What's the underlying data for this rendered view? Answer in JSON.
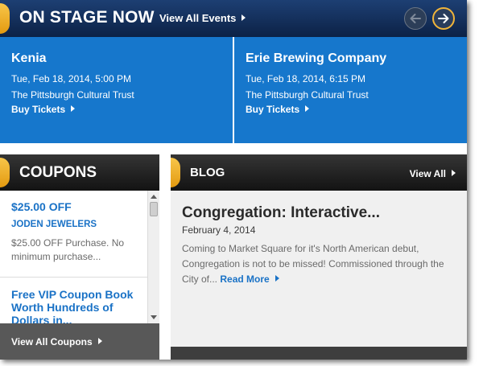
{
  "stage": {
    "title": "ON STAGE NOW",
    "view_all": "View All Events",
    "prev_icon": "arrow-left-icon",
    "next_icon": "arrow-right-icon"
  },
  "events": [
    {
      "name": "Kenia",
      "date": "Tue, Feb 18, 2014, 5:00 PM",
      "venue": "The Pittsburgh Cultural Trust",
      "buy": "Buy Tickets"
    },
    {
      "name": "Erie Brewing Company",
      "date": "Tue, Feb 18, 2014, 6:15 PM",
      "venue": "The Pittsburgh Cultural Trust",
      "buy": "Buy Tickets"
    }
  ],
  "coupons": {
    "title": "COUPONS",
    "items": [
      {
        "title": "$25.00 OFF",
        "merchant": "JODEN JEWELERS",
        "description": "$25.00 OFF Purchase. No minimum purchase..."
      },
      {
        "title": "Free VIP Coupon Book Worth Hundreds of Dollars in..."
      }
    ],
    "view_all": "View All Coupons"
  },
  "blog": {
    "title": "BLOG",
    "view_all": "View All",
    "post": {
      "title": "Congregation: Interactive...",
      "date": "February 4, 2014",
      "excerpt": "Coming to Market Square for it's North American debut, Congregation is not to be missed! Commissioned through the City of...",
      "read_more": "Read More"
    }
  },
  "colors": {
    "stage_header": "#14305c",
    "event_blue": "#1677cc",
    "accent_orange": "#f0a820",
    "link_blue": "#1a72c6",
    "dark_header": "#1e1e1e"
  }
}
